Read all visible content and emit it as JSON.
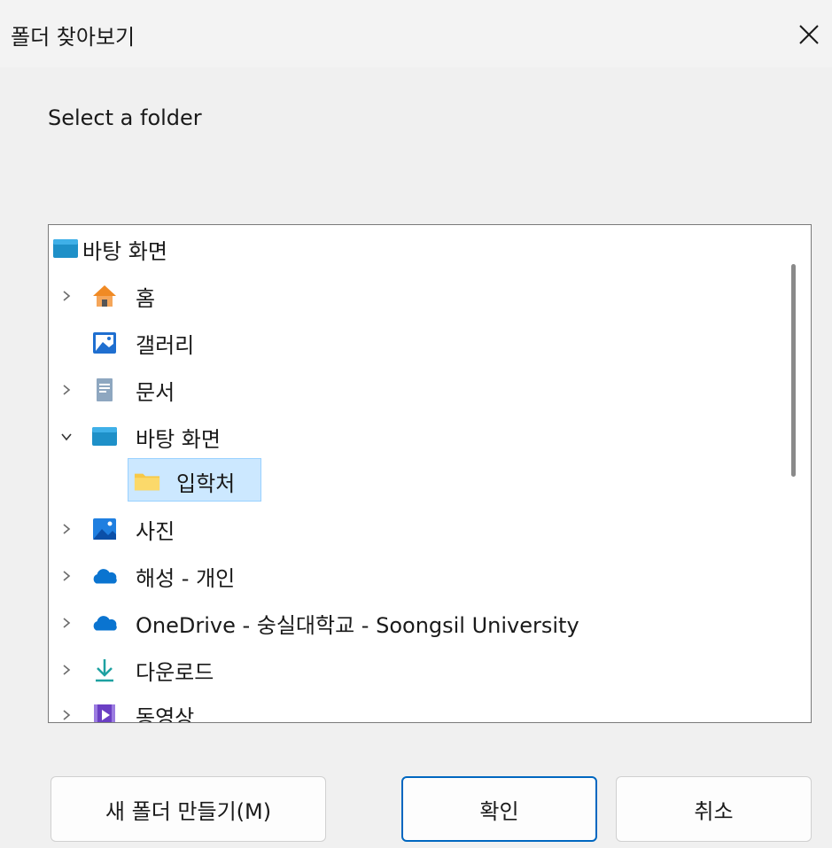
{
  "window": {
    "title": "폴더 찾아보기"
  },
  "prompt": "Select a folder",
  "tree": {
    "root_label": "바탕 화면",
    "items": [
      {
        "label": "홈"
      },
      {
        "label": "갤러리"
      },
      {
        "label": "문서"
      },
      {
        "label": "바탕 화면"
      },
      {
        "label": "입학처"
      },
      {
        "label": "사진"
      },
      {
        "label": "해성 - 개인"
      },
      {
        "label": "OneDrive - 숭실대학교 - Soongsil University"
      },
      {
        "label": "다운로드"
      },
      {
        "label": "동영상"
      }
    ],
    "selected": "입학처"
  },
  "buttons": {
    "new_folder": "새 폴더 만들기(M)",
    "ok": "확인",
    "cancel": "취소"
  },
  "colors": {
    "accent": "#0067c0",
    "selection": "#cce8ff",
    "desktop_icon": "#1e90c8",
    "home_icon": "#f08a24",
    "onedrive_icon": "#0a74d0",
    "download_icon": "#1da1a1",
    "video_icon": "#6b3fc4",
    "folder_icon": "#f7c948"
  }
}
